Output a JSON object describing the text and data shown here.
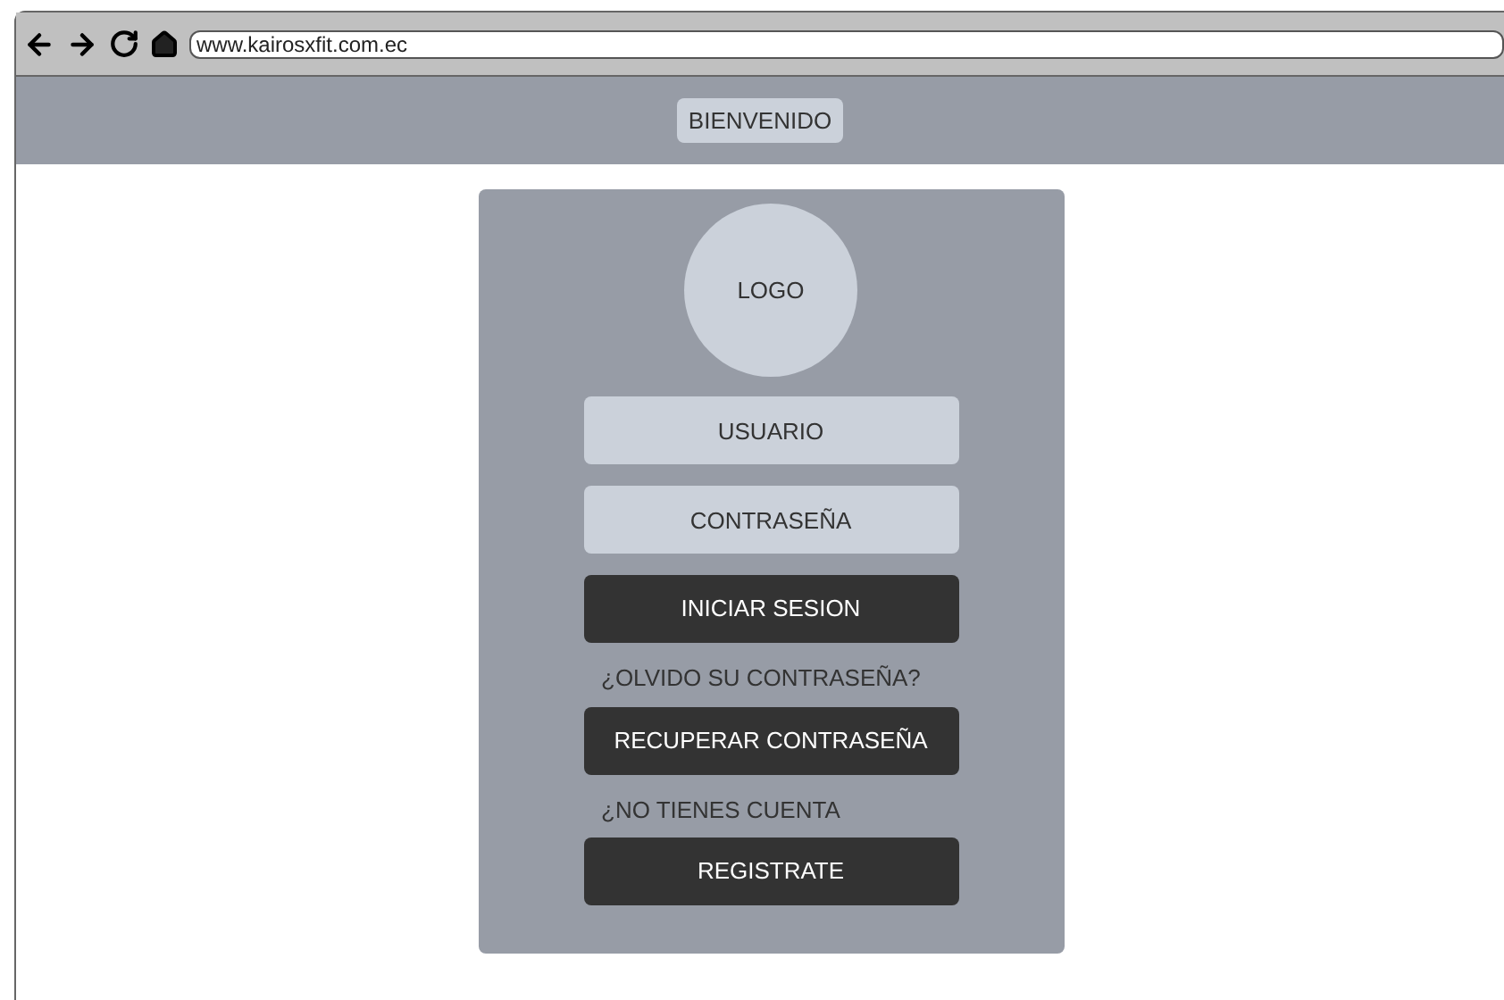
{
  "browser": {
    "url": "www.kairosxfit.com.ec"
  },
  "header": {
    "title": "BIENVENIDO"
  },
  "login_card": {
    "logo": "LOGO",
    "items": [
      {
        "kind": "field",
        "placeholder": "USUARIO"
      },
      {
        "kind": "field",
        "placeholder": "CONTRASEÑA"
      },
      {
        "kind": "button",
        "label": "INICIAR SESION"
      },
      {
        "kind": "text",
        "label": "¿OLVIDO SU CONTRASEÑA?"
      },
      {
        "kind": "button",
        "label": "RECUPERAR CONTRASEÑA"
      },
      {
        "kind": "text",
        "label": "¿NO TIENES CUENTA"
      },
      {
        "kind": "button",
        "label": "REGISTRATE"
      }
    ]
  }
}
